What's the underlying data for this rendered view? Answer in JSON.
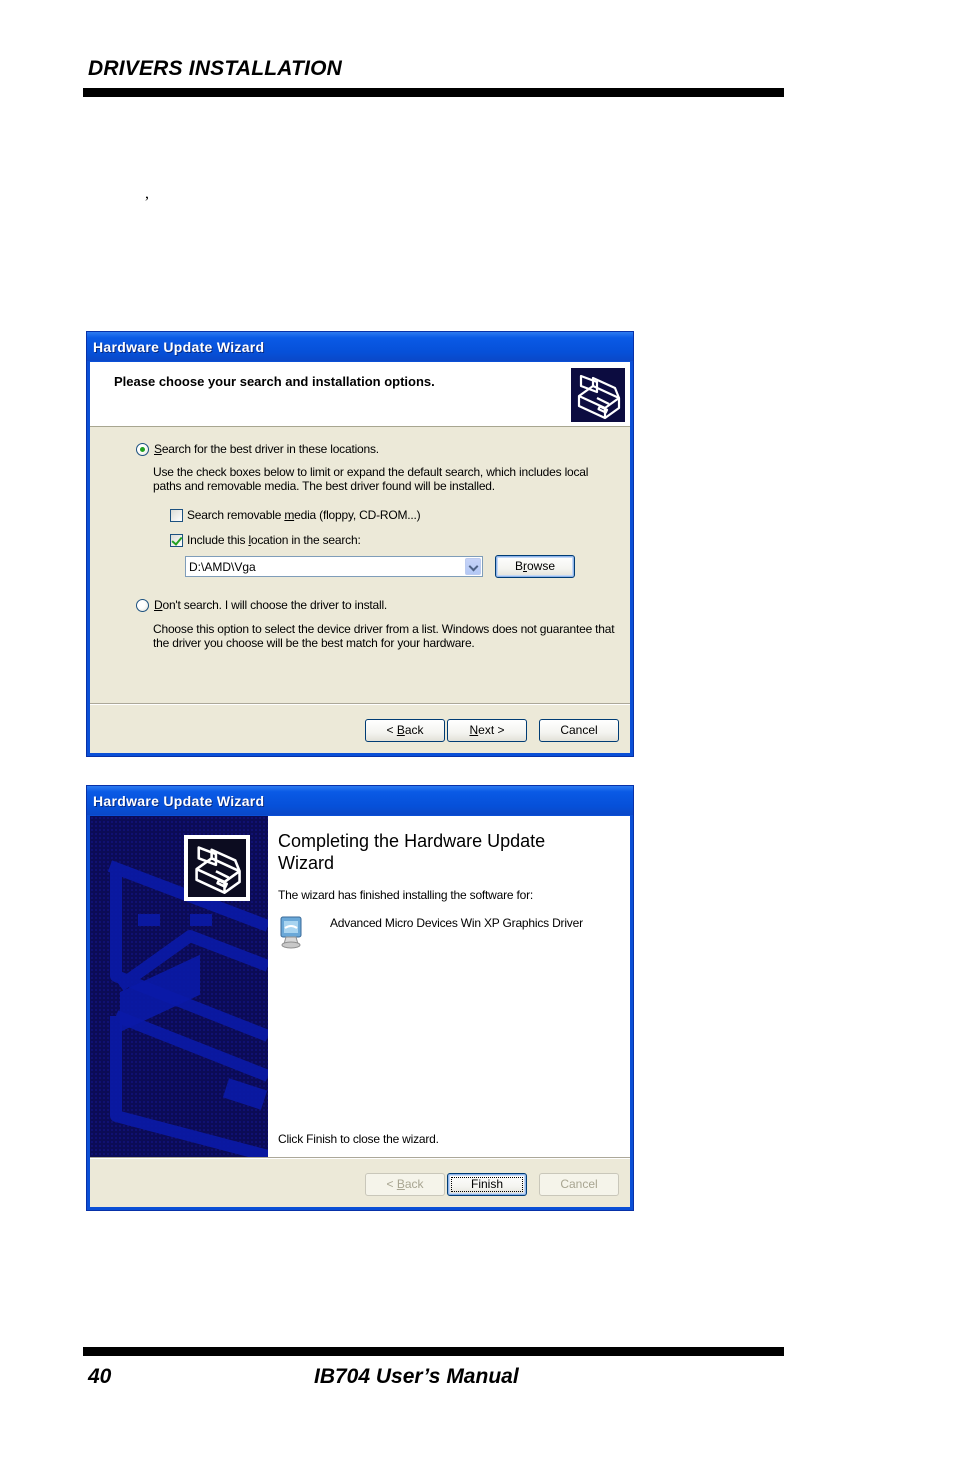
{
  "document": {
    "header": "DRIVERS INSTALLATION",
    "stray_text": ",",
    "footer_page_number": "40",
    "footer_title": "IB704 User’s Manual"
  },
  "dialog1": {
    "title": "Hardware Update Wizard",
    "banner_title": "Please choose your search and installation options.",
    "banner_icon": "hardware-wizard-icon",
    "option_search": {
      "label_prefix": "",
      "accel": "S",
      "label_rest": "earch for the best driver in these locations.",
      "selected": true
    },
    "search_description_line1": "Use the check boxes below to limit or expand the default search, which includes local",
    "search_description_line2": "paths and removable media. The best driver found will be installed.",
    "checkbox_removable": {
      "label_prefix": "Search removable ",
      "accel": "m",
      "label_rest": "edia (floppy, CD-ROM...)",
      "checked": false
    },
    "checkbox_location": {
      "label_prefix": "Include this ",
      "accel": "l",
      "label_rest": "ocation in the search:",
      "checked": true
    },
    "location_value": "D:\\AMD\\Vga",
    "browse_button": {
      "prefix": "B",
      "accel": "r",
      "rest": "owse"
    },
    "option_dont_search": {
      "accel": "D",
      "label_rest": "on't search. I will choose the driver to install.",
      "selected": false
    },
    "dont_search_description_line1": "Choose this option to select the device driver from a list.  Windows does not guarantee that",
    "dont_search_description_line2": "the driver you choose will be the best match for your hardware.",
    "buttons": {
      "back": {
        "prefix": "< ",
        "accel": "B",
        "rest": "ack"
      },
      "next": {
        "accel": "N",
        "rest": "ext >"
      },
      "cancel": "Cancel"
    }
  },
  "dialog2": {
    "title": "Hardware Update Wizard",
    "headline": "Completing the Hardware Update Wizard",
    "finished_text": "The wizard has finished installing the software for:",
    "device_name": "Advanced Micro Devices Win XP Graphics Driver",
    "device_icon": "display-monitor-icon",
    "close_hint": "Click Finish to close the wizard.",
    "buttons": {
      "back": {
        "prefix": "< ",
        "accel": "B",
        "rest": "ack",
        "enabled": false
      },
      "finish": "Finish",
      "cancel": {
        "label": "Cancel",
        "enabled": false
      }
    }
  },
  "colors": {
    "xp_titlebar_blue": "#0a5ae6",
    "xp_dialog_face": "#ece9d8",
    "wizard_sidebar_navy": "#0b0b56",
    "radio_check_green": "#21a121"
  }
}
